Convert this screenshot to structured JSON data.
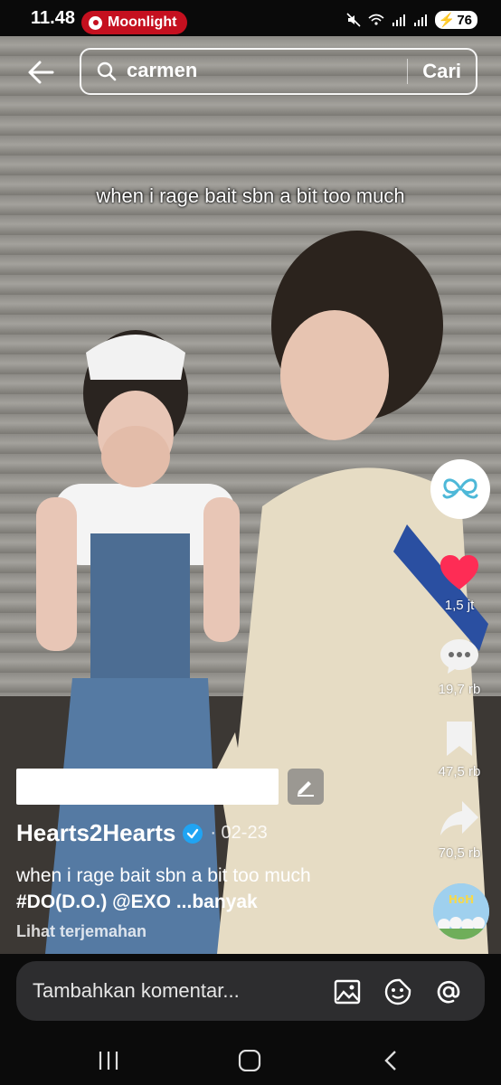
{
  "status_bar": {
    "time": "11.48",
    "notification_app": "Moonlight",
    "battery": "76"
  },
  "search": {
    "query": "carmen",
    "submit_label": "Cari"
  },
  "video": {
    "caption_overlay": "when i rage bait sbn a bit too much"
  },
  "actions": {
    "likes": "1,5 jt",
    "comments": "19,7 rb",
    "saves": "47,5 rb",
    "shares": "70,5 rb",
    "like_color": "#fe2c55"
  },
  "post": {
    "author": "Hearts2Hearts",
    "date": "· 02-23",
    "description": "when i rage bait sbn a bit too much",
    "tags": "#DO(D.O.) @EXO",
    "more": " ...banyak",
    "translate_label": "Lihat terjemahan"
  },
  "comment_bar": {
    "placeholder": "Tambahkan komentar..."
  },
  "icons": [
    "back-arrow-icon",
    "search-icon",
    "heart-icon",
    "comment-icon",
    "bookmark-icon",
    "share-icon",
    "image-icon",
    "sticker-icon",
    "mention-icon"
  ]
}
